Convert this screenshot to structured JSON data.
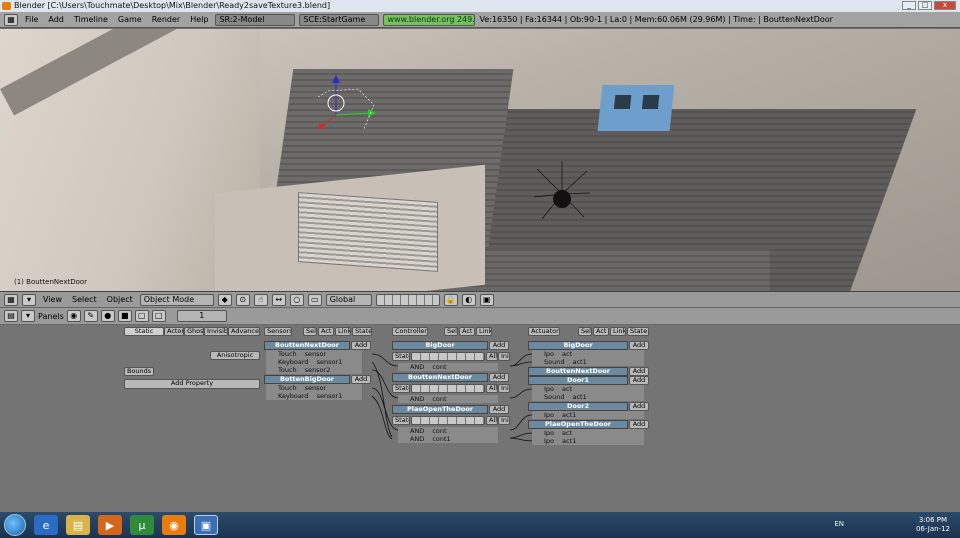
{
  "window": {
    "title": "Blender [C:\\Users\\Touchmate\\Desktop\\Mix\\Blender\\Ready2saveTexture3.blend]",
    "buttons": [
      "_",
      "□",
      "x"
    ]
  },
  "topbar": {
    "menus": [
      "File",
      "Add",
      "Timeline",
      "Game",
      "Render",
      "Help"
    ],
    "screen": "SR:2-Model",
    "scene": "SCE:StartGame",
    "url": "www.blender.org 249.2",
    "stats": "Ve:16350 | Fa:16344 | Ob:90-1 | La:0 | Mem:60.06M (29.96M) | Time: | BouttenNextDoor"
  },
  "viewport": {
    "object_label": "(1) BouttenNextDoor"
  },
  "view3d_header": {
    "menus": [
      "View",
      "Select",
      "Object"
    ],
    "mode": "Object Mode",
    "orientation": "Global"
  },
  "buttons_header": {
    "panels_label": "Panels",
    "frame": "1"
  },
  "logic": {
    "left": {
      "static_btn": "Static",
      "actor": "Actor",
      "ghost": "Ghost",
      "invisible": "Invisible",
      "advanced": "Advanced",
      "anisotropic": "Anisotropic",
      "bounds": "Bounds",
      "add_property": "Add Property"
    },
    "sensors": {
      "label": "Sensors",
      "opts": [
        "Sel",
        "Act",
        "Link",
        "State"
      ],
      "blocks": [
        {
          "name": "BouttenNextDoor",
          "add": "Add",
          "rows": [
            [
              "Touch",
              "sensor"
            ],
            [
              "Keyboard",
              "sensor1"
            ],
            [
              "Touch",
              "sensor2"
            ]
          ]
        },
        {
          "name": "BottenBigDoor",
          "add": "Add",
          "rows": [
            [
              "Touch",
              "sensor"
            ],
            [
              "Keyboard",
              "sensor1"
            ]
          ]
        }
      ]
    },
    "controllers": {
      "label": "Controllers",
      "opts": [
        "Sel",
        "Act",
        "Link"
      ],
      "blocks": [
        {
          "name": "BigDoor",
          "add": "Add",
          "state": "State",
          "all": "All",
          "ini": "Ini",
          "rows": [
            [
              "AND",
              "cont"
            ]
          ]
        },
        {
          "name": "BouttenNextDoor",
          "add": "Add",
          "state": "State",
          "all": "All",
          "ini": "Ini",
          "rows": [
            [
              "AND",
              "cont"
            ]
          ]
        },
        {
          "name": "PlaeOpenTheDoor",
          "add": "Add",
          "state": "State",
          "all": "All",
          "ini": "Ini",
          "rows": [
            [
              "AND",
              "cont"
            ],
            [
              "AND",
              "cont1"
            ]
          ]
        }
      ]
    },
    "actuators": {
      "label": "Actuators",
      "opts": [
        "Sel",
        "Act",
        "Link",
        "State"
      ],
      "blocks": [
        {
          "name": "BigDoor",
          "add": "Add",
          "rows": [
            [
              "Ipo",
              "act"
            ],
            [
              "Sound",
              "act1"
            ]
          ]
        },
        {
          "name": "BouttenNextDoor",
          "add": "Add",
          "rows": []
        },
        {
          "name": "Door1",
          "add": "Add",
          "rows": [
            [
              "Ipo",
              "act"
            ],
            [
              "Sound",
              "act1"
            ]
          ]
        },
        {
          "name": "Door2",
          "add": "Add",
          "rows": [
            [
              "Ipo",
              "act1"
            ]
          ]
        },
        {
          "name": "PlaeOpenTheDoor",
          "add": "Add",
          "rows": [
            [
              "Ipo",
              "act"
            ],
            [
              "Ipo",
              "act1"
            ]
          ]
        }
      ]
    }
  },
  "taskbar": {
    "lang": "EN",
    "time": "3:06 PM",
    "date": "06-Jan-12"
  }
}
